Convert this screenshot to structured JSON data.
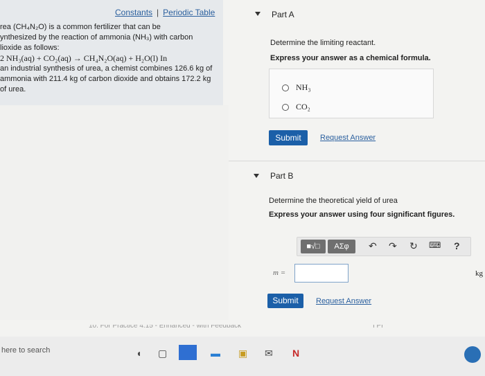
{
  "left": {
    "links": {
      "constants": "Constants",
      "separator": "|",
      "periodic_table": "Periodic Table"
    },
    "problem_lines": [
      "rea (CH₄N₂O) is a common fertilizer that can be",
      "ynthesized by the reaction of ammonia (NH₃) with carbon",
      "lioxide as follows:",
      "2 NH₃(aq) + CO₂(aq) → CH₄N₂O(aq) + H₂O(l) In",
      "an industrial synthesis of urea, a chemist combines 126.6 kg of",
      "ammonia with 211.4 kg of carbon dioxide and obtains 172.2 kg",
      "of urea."
    ]
  },
  "partA": {
    "title": "Part A",
    "instruction": "Determine the limiting reactant.",
    "format_hint": "Express your answer as a chemical formula.",
    "options": [
      "NH₃",
      "CO₂"
    ],
    "submit_label": "Submit",
    "request_label": "Request Answer"
  },
  "partB": {
    "title": "Part B",
    "instruction": "Determine the theoretical yield of urea",
    "format_hint": "Express your answer using four significant figures.",
    "toolbar": {
      "templates": "■√□",
      "greek": "ΑΣφ",
      "undo": "↶",
      "redo": "↷",
      "reset": "↻",
      "keyboard": "⌨",
      "help": "?"
    },
    "variable_label": "m =",
    "unit": "kg",
    "input_value": "",
    "submit_label": "Submit",
    "request_label": "Request Answer"
  },
  "footer_partial": "10. For Practice 4.15 - Enhanced - with Feedback",
  "footer_right_partial": "I Pr",
  "taskbar": {
    "search_placeholder": "here to search"
  }
}
